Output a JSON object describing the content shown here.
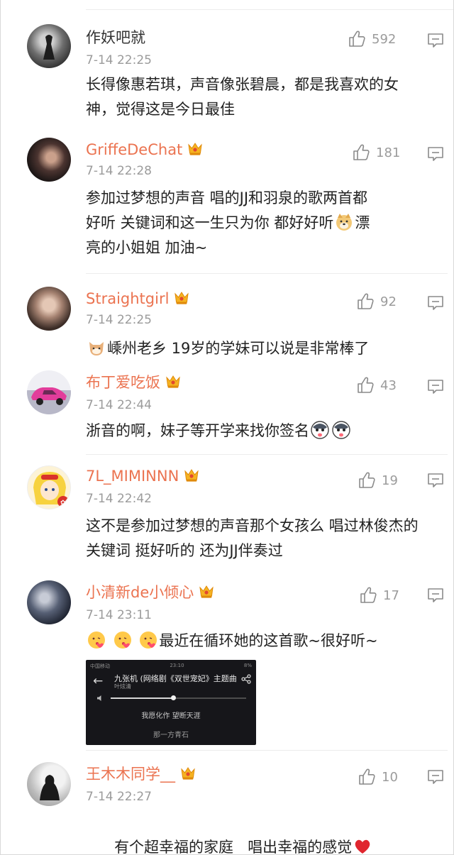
{
  "comments": [
    {
      "username": "作妖吧就",
      "timestamp": "7-14 22:25",
      "likes": "592",
      "vip": false,
      "text": "长得像惠若琪，声音像张碧晨，都是我喜欢的女神，觉得这是今日最佳"
    },
    {
      "username": "GriffeDeChat",
      "timestamp": "7-14 22:28",
      "likes": "181",
      "vip": true,
      "text_lines": [
        "参加过梦想的声音 唱的JJ和羽泉的歌两首都",
        "好听 关键词和这一生只为你 都好好听",
        "漂",
        "亮的小姐姐 加油~"
      ]
    },
    {
      "username": "Straightgirl",
      "timestamp": "7-14 22:25",
      "likes": "92",
      "vip": true,
      "text": "嵊州老乡 19岁的学妹可以说是非常棒了"
    },
    {
      "username": "布丁爱吃饭",
      "timestamp": "7-14 22:44",
      "likes": "43",
      "vip": true,
      "text": "浙音的啊，妹子等开学来找你签名"
    },
    {
      "username": "7L_MIMINNN",
      "timestamp": "7-14 22:42",
      "likes": "19",
      "vip": true,
      "text": "这不是参加过梦想的声音那个女孩么 唱过林俊杰的关键词 挺好听的 还为JJ伴奏过"
    },
    {
      "username": "小清新de小倾心",
      "timestamp": "7-14 23:11",
      "likes": "17",
      "vip": true,
      "text": "最近在循环她的这首歌~很好听~",
      "attachment": {
        "status_left": "中国移动",
        "status_time": "23:10",
        "status_right": "8%",
        "song_title": "九张机 (网络剧《双世宠妃》主题曲",
        "artist": "叶炫清",
        "lyric_1": "我愿化作 望断天涯",
        "lyric_2": "那一方青石",
        "progress": 0.46
      }
    },
    {
      "username": "王木木同学__",
      "timestamp": "7-14 22:27",
      "likes": "10",
      "vip": true,
      "text": "有个超幸福的家庭   唱出幸福的感觉"
    }
  ],
  "colors": {
    "vip_name": "#eb7350",
    "meta_gray": "#9b9b9b",
    "crown_gold": "#f5b321"
  },
  "icons": {
    "like": "thumbs-up-icon",
    "reply": "comment-bubble-icon",
    "vip": "crown-badge-icon"
  }
}
